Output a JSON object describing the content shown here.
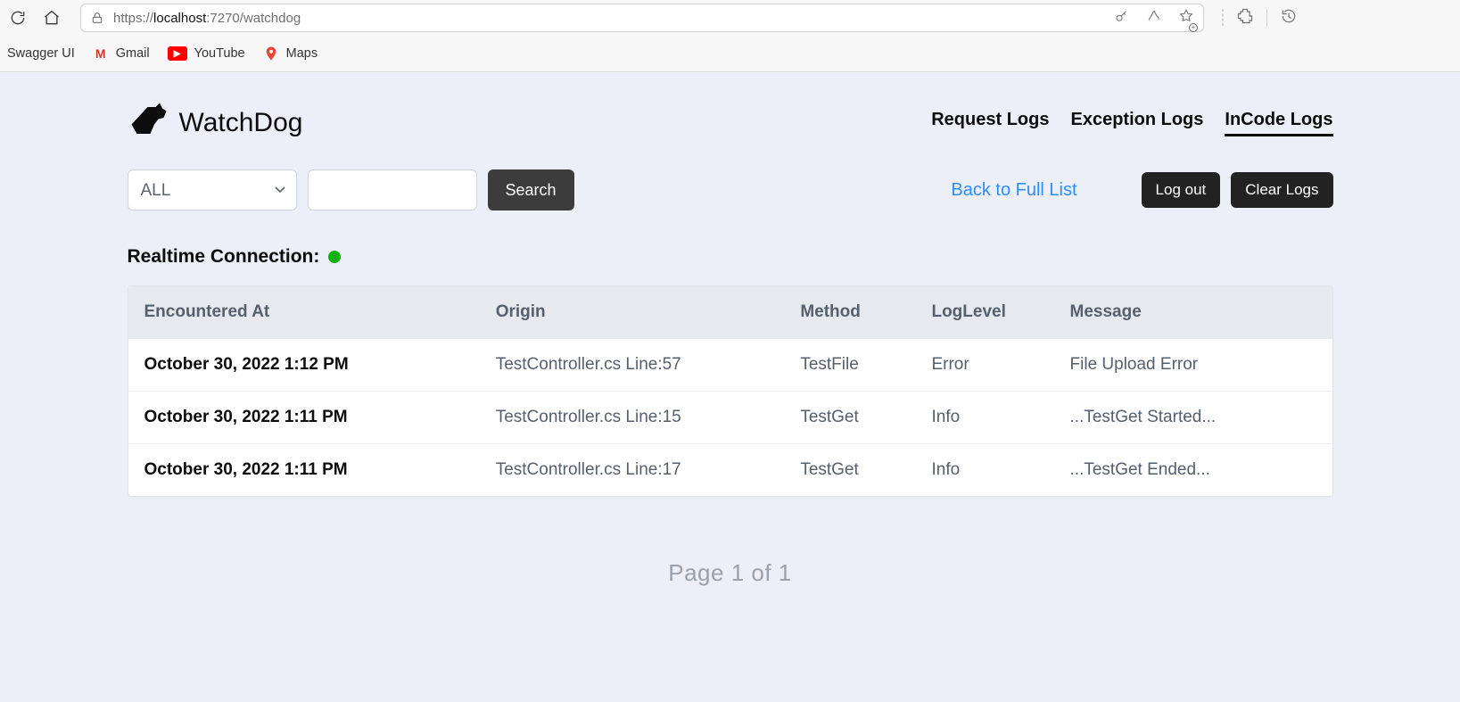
{
  "browser": {
    "url_prefix": "https://",
    "url_host": "localhost",
    "url_port": ":7270",
    "url_path": "/watchdog",
    "bookmarks": [
      {
        "label": "Swagger UI"
      },
      {
        "label": "Gmail"
      },
      {
        "label": "YouTube"
      },
      {
        "label": "Maps"
      }
    ]
  },
  "app": {
    "brand": "WatchDog",
    "nav": [
      {
        "label": "Request Logs",
        "active": false
      },
      {
        "label": "Exception Logs",
        "active": false
      },
      {
        "label": "InCode Logs",
        "active": true
      }
    ],
    "filter_selected": "ALL",
    "search_value": "",
    "search_button": "Search",
    "back_link": "Back to Full List",
    "logout_button": "Log out",
    "clear_button": "Clear Logs",
    "realtime_label": "Realtime Connection:",
    "realtime_status_color": "#0fb20f",
    "table": {
      "headers": [
        "Encountered At",
        "Origin",
        "Method",
        "LogLevel",
        "Message"
      ],
      "rows": [
        {
          "encountered_at": "October 30, 2022 1:12 PM",
          "origin": "TestController.cs Line:57",
          "method": "TestFile",
          "level": "Error",
          "message": "File Upload Error"
        },
        {
          "encountered_at": "October 30, 2022 1:11 PM",
          "origin": "TestController.cs Line:15",
          "method": "TestGet",
          "level": "Info",
          "message": "...TestGet Started..."
        },
        {
          "encountered_at": "October 30, 2022 1:11 PM",
          "origin": "TestController.cs Line:17",
          "method": "TestGet",
          "level": "Info",
          "message": "...TestGet Ended..."
        }
      ]
    },
    "pager": "Page 1 of 1"
  }
}
